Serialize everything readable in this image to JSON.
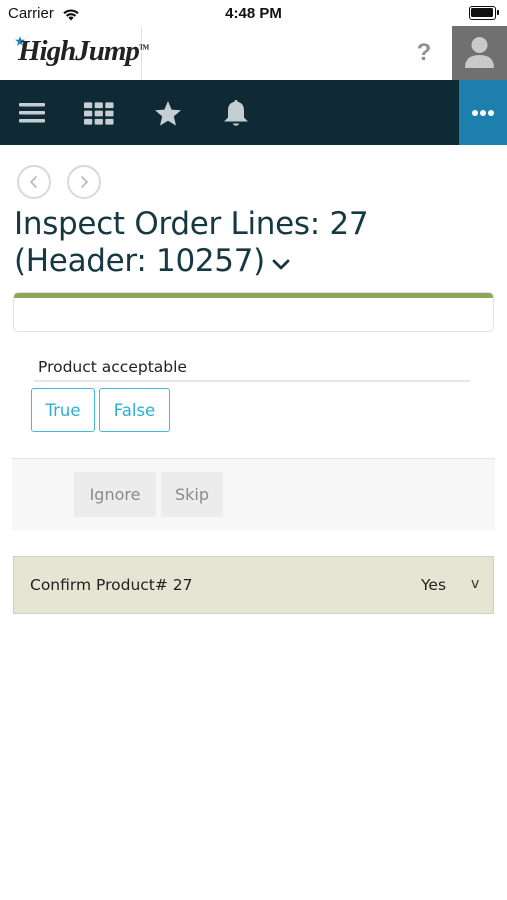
{
  "status_bar": {
    "carrier": "Carrier",
    "time": "4:48 PM"
  },
  "header": {
    "logo_text": "HighJump",
    "logo_tm": "TM",
    "help_label": "?"
  },
  "navbar": {
    "icons": [
      "menu-icon",
      "grid-icon",
      "star-icon",
      "bell-icon",
      "more-icon"
    ],
    "more_bg": "#1d7fad",
    "bg": "#0f2a35"
  },
  "page": {
    "title": "Inspect Order Lines: 27 (Header: 10257)",
    "progress_fraction": 1.0,
    "progress_color": "#8fa55a"
  },
  "question": {
    "label": "Product acceptable",
    "options": [
      "True",
      "False"
    ],
    "accent": "#29b0d2"
  },
  "actions": {
    "ignore": "Ignore",
    "skip": "Skip"
  },
  "confirm": {
    "label": "Confirm Product# 27",
    "value": "Yes",
    "toggle": "v"
  }
}
